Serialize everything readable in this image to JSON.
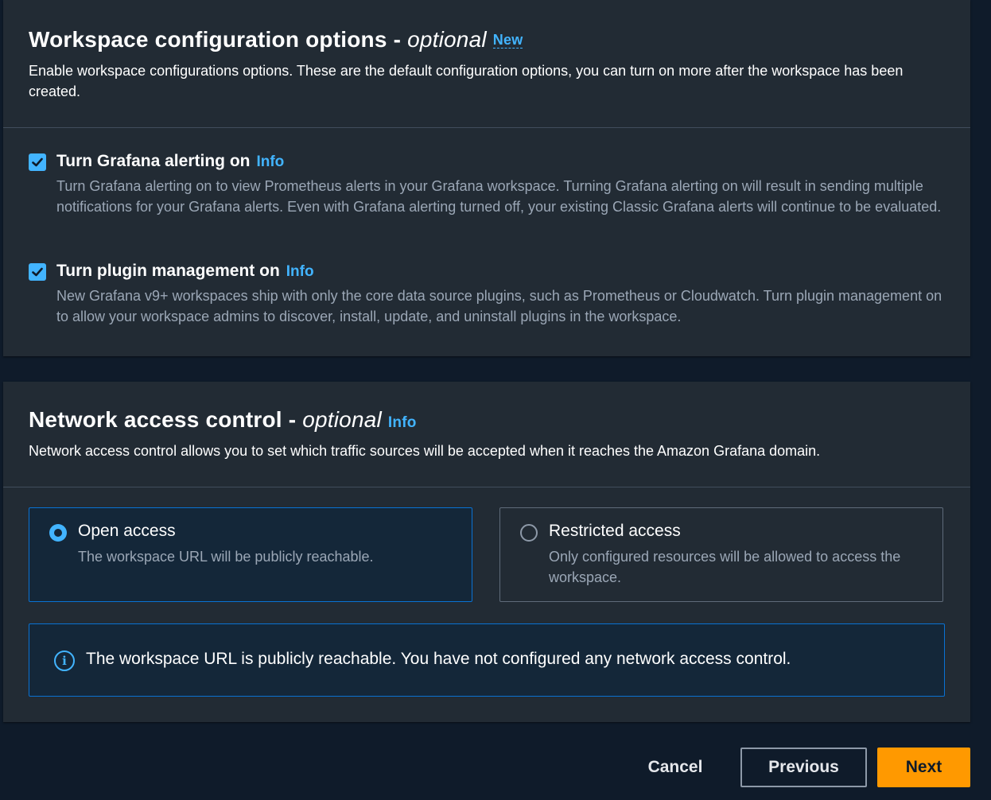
{
  "workspace_config": {
    "title": "Workspace configuration options -",
    "optional": "optional",
    "new_badge": "New",
    "description": "Enable workspace configurations options. These are the default configuration options, you can turn on more after the workspace has been created.",
    "options": [
      {
        "label": "Turn Grafana alerting on",
        "info": "Info",
        "checked": true,
        "description": "Turn Grafana alerting on to view Prometheus alerts in your Grafana workspace. Turning Grafana alerting on will result in sending multiple notifications for your Grafana alerts. Even with Grafana alerting turned off, your existing Classic Grafana alerts will continue to be evaluated."
      },
      {
        "label": "Turn plugin management on",
        "info": "Info",
        "checked": true,
        "description": "New Grafana v9+ workspaces ship with only the core data source plugins, such as Prometheus or Cloudwatch. Turn plugin management on to allow your workspace admins to discover, install, update, and uninstall plugins in the workspace."
      }
    ]
  },
  "network_access": {
    "title": "Network access control -",
    "optional": "optional",
    "info": "Info",
    "description": "Network access control allows you to set which traffic sources will be accepted when it reaches the Amazon Grafana domain.",
    "tiles": [
      {
        "label": "Open access",
        "description": "The workspace URL will be publicly reachable.",
        "selected": true
      },
      {
        "label": "Restricted access",
        "description": "Only configured resources will be allowed to access the workspace.",
        "selected": false
      }
    ],
    "alert": {
      "icon": "info-circle-icon",
      "text": "The workspace URL is publicly reachable. You have not configured any network access control."
    }
  },
  "footer": {
    "cancel": "Cancel",
    "previous": "Previous",
    "next": "Next"
  },
  "colors": {
    "accent": "#42b4ff",
    "primary_button": "#ff9900",
    "selected_border": "#0972d3",
    "panel": "#222b34",
    "page": "#0f1b2a"
  }
}
